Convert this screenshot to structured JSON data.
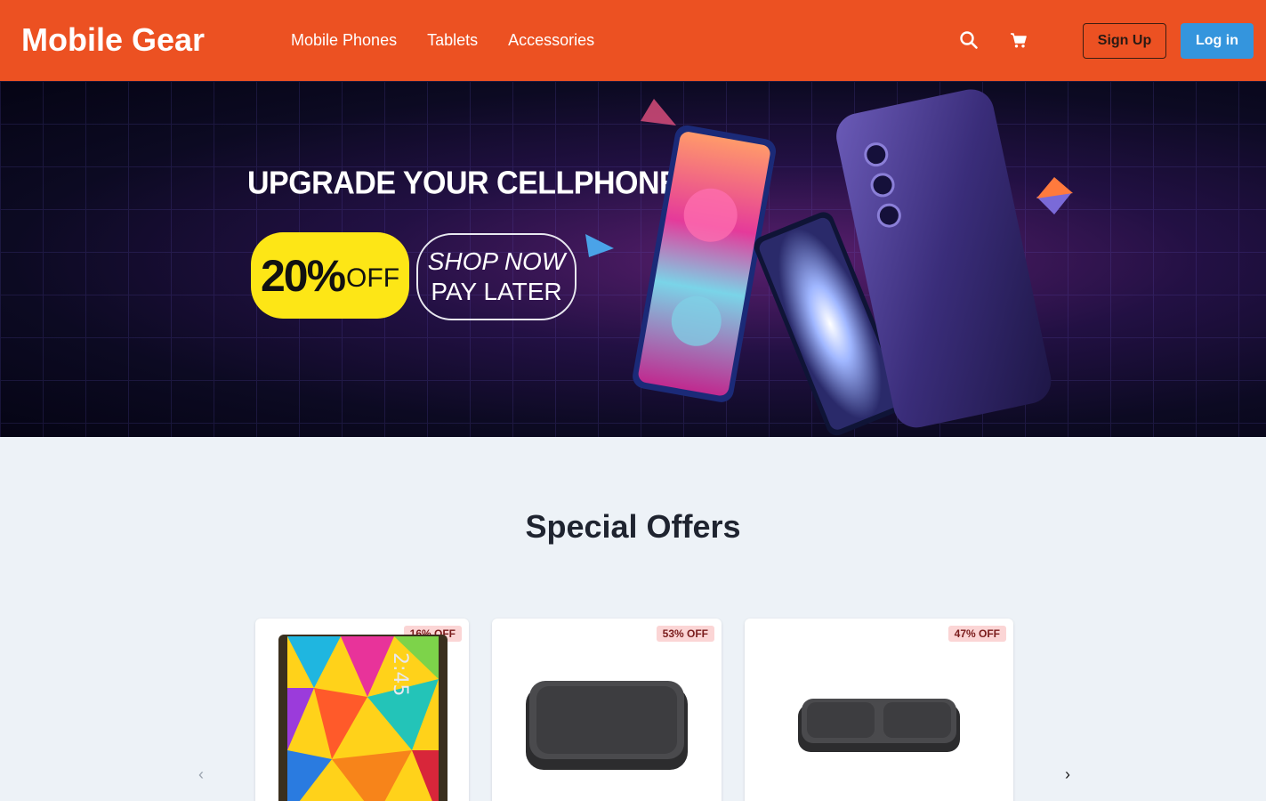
{
  "header": {
    "brand": "Mobile Gear",
    "nav": [
      "Mobile Phones",
      "Tablets",
      "Accessories"
    ],
    "icons": [
      "search-icon",
      "cart-icon"
    ],
    "signup_label": "Sign Up",
    "login_label": "Log in",
    "colors": {
      "bar": "#ec5122",
      "login_button": "#3495dd"
    }
  },
  "hero": {
    "headline": "UPGRADE YOUR CELLPHONE",
    "discount_value": "20%",
    "discount_suffix": "OFF",
    "cta_line1": "SHOP NOW",
    "cta_line2": "PAY LATER",
    "accent_color": "#fde616"
  },
  "offers": {
    "title": "Special Offers",
    "products": [
      {
        "discount": "16% OFF",
        "image": "tablet"
      },
      {
        "discount": "53% OFF",
        "image": "wireless-charger-pad"
      },
      {
        "discount": "47% OFF",
        "image": "wireless-charger-duo"
      }
    ],
    "prev_icon": "chevron-left-icon",
    "next_icon": "chevron-right-icon"
  }
}
